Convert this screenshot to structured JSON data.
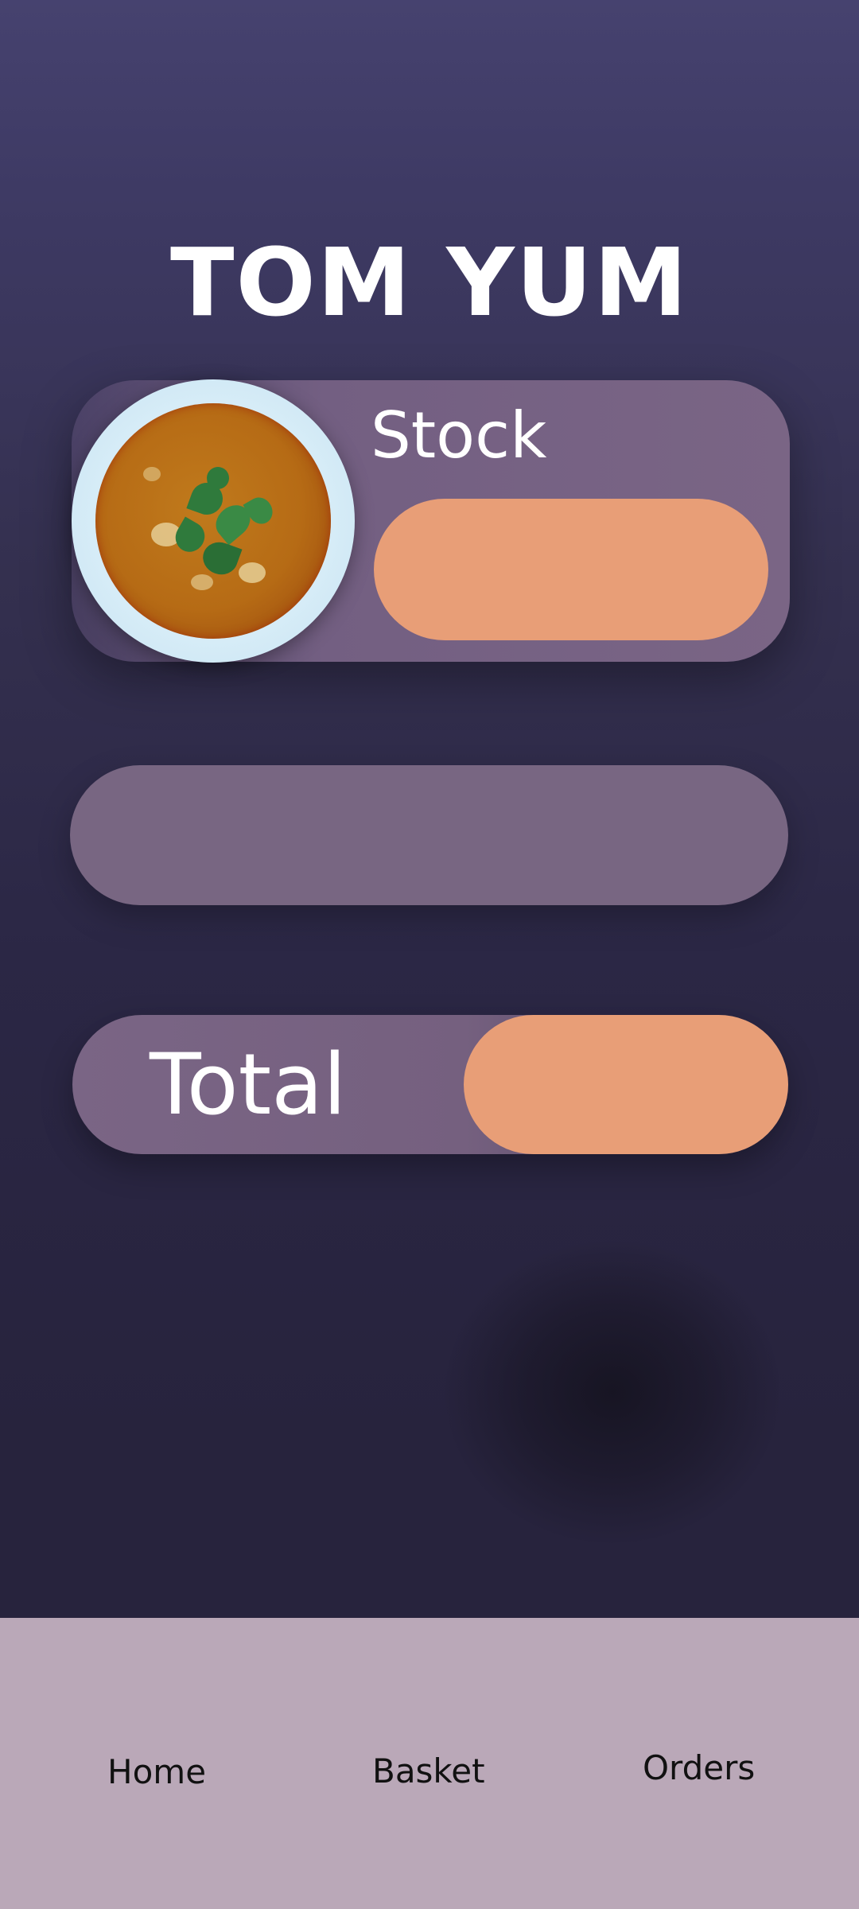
{
  "header": {
    "title": "TOM YUM"
  },
  "product": {
    "image": "tom-yum-soup-bowl",
    "stock_label": "Stock"
  },
  "summary": {
    "total_label": "Total"
  },
  "nav": {
    "items": [
      {
        "label": "Home"
      },
      {
        "label": "Basket"
      },
      {
        "label": "Orders"
      }
    ]
  },
  "colors": {
    "background_top": "#46426f",
    "background_bottom": "#27233d",
    "card": "#786682",
    "accent_pill": "#e89e77",
    "nav_background": "#baa8b8"
  }
}
